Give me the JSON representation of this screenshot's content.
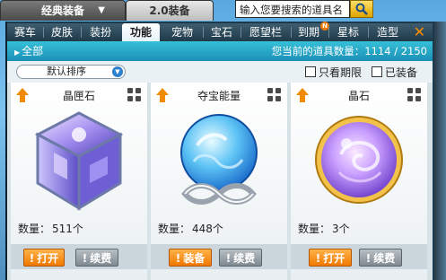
{
  "top_tabs": {
    "classic": "经典装备",
    "v20": "2.0装备"
  },
  "search": {
    "placeholder": "输入您要搜索的道具名"
  },
  "categories": [
    {
      "label": "赛车",
      "active": false
    },
    {
      "label": "皮肤",
      "active": false
    },
    {
      "label": "装扮",
      "active": false
    },
    {
      "label": "功能",
      "active": true
    },
    {
      "label": "宠物",
      "active": false
    },
    {
      "label": "宝石",
      "active": false
    },
    {
      "label": "愿望栏",
      "active": false
    },
    {
      "label": "到期",
      "active": false,
      "badge": "N"
    },
    {
      "label": "星标",
      "active": false
    },
    {
      "label": "造型",
      "active": false
    }
  ],
  "filter": {
    "all_label": "全部",
    "count_text": "您当前的道具数量：1114 / 2150"
  },
  "options": {
    "sort_value": "默认排序",
    "only_expiry": "只看期限",
    "equipped": "已装备"
  },
  "items": [
    {
      "name": "晶匣石",
      "qty_label": "数量：",
      "qty": "511个",
      "primary": "打开",
      "secondary": "续费"
    },
    {
      "name": "夺宝能量",
      "qty_label": "数量：",
      "qty": "448个",
      "primary": "装备",
      "secondary": "续费"
    },
    {
      "name": "晶石",
      "qty_label": "数量：",
      "qty": "3个",
      "primary": "打开",
      "secondary": "续费"
    }
  ],
  "colors": {
    "accent_orange": "#f07800",
    "filter_bar": "#1b8fb5",
    "category_bar": "#1f3a4a"
  }
}
